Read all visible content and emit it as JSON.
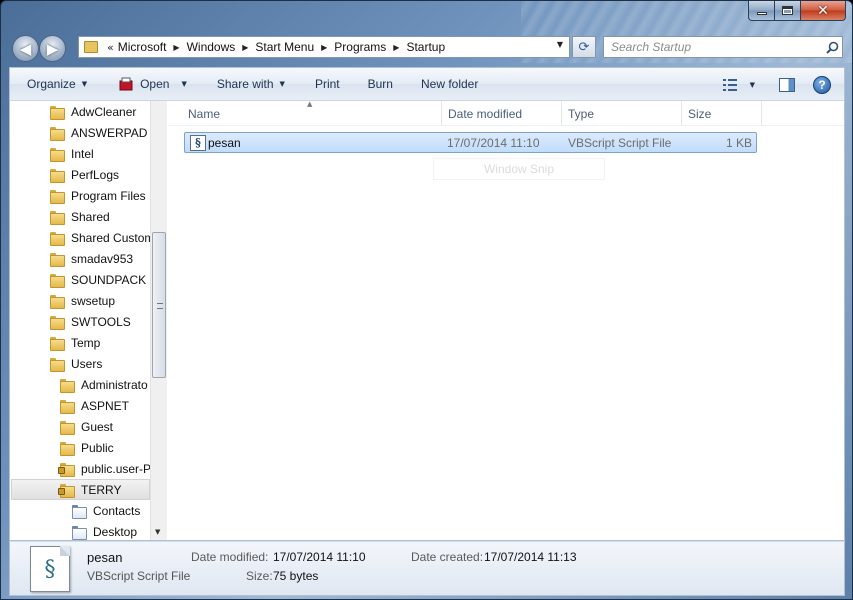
{
  "window": {
    "caption": {
      "minimize": "minimize",
      "maximize": "maximize",
      "close": "close"
    }
  },
  "address": {
    "prefix": "«",
    "segments": [
      "Microsoft",
      "Windows",
      "Start Menu",
      "Programs",
      "Startup"
    ]
  },
  "search": {
    "placeholder": "Search Startup"
  },
  "toolbar": {
    "organize": "Organize",
    "open": "Open",
    "share_with": "Share with",
    "print": "Print",
    "burn": "Burn",
    "new_folder": "New folder"
  },
  "tree": {
    "items": [
      {
        "label": "AdwCleaner",
        "icon": "folder-icon"
      },
      {
        "label": "ANSWERPAD",
        "icon": "folder-icon"
      },
      {
        "label": "Intel",
        "icon": "folder-icon"
      },
      {
        "label": "PerfLogs",
        "icon": "folder-icon"
      },
      {
        "label": "Program Files",
        "icon": "folder-icon"
      },
      {
        "label": "Shared",
        "icon": "folder-icon"
      },
      {
        "label": "Shared Custom",
        "icon": "folder-icon"
      },
      {
        "label": "smadav953",
        "icon": "folder-icon"
      },
      {
        "label": "SOUNDPACK",
        "icon": "folder-icon"
      },
      {
        "label": "swsetup",
        "icon": "folder-icon"
      },
      {
        "label": "SWTOOLS",
        "icon": "folder-icon"
      },
      {
        "label": "Temp",
        "icon": "folder-icon"
      },
      {
        "label": "Users",
        "icon": "folder-icon"
      },
      {
        "label": "Administrato",
        "icon": "folder-icon"
      },
      {
        "label": "ASPNET",
        "icon": "folder-icon"
      },
      {
        "label": "Guest",
        "icon": "folder-icon"
      },
      {
        "label": "Public",
        "icon": "folder-icon"
      },
      {
        "label": "public.user-P",
        "icon": "locked-folder-icon"
      },
      {
        "label": "TERRY",
        "icon": "locked-folder-icon"
      },
      {
        "label": "Contacts",
        "icon": "contacts-folder-icon"
      },
      {
        "label": "Desktop",
        "icon": "desktop-folder-icon"
      }
    ]
  },
  "columns": {
    "name": "Name",
    "date_modified": "Date modified",
    "type": "Type",
    "size": "Size"
  },
  "files": [
    {
      "name": "pesan",
      "date_modified": "17/07/2014 11:10",
      "type": "VBScript Script File",
      "size": "1 KB"
    }
  ],
  "overlay": {
    "snip": "Window Snip"
  },
  "details": {
    "name": "pesan",
    "type": "VBScript Script File",
    "date_modified_label": "Date modified:",
    "date_modified": "17/07/2014 11:10",
    "date_created_label": "Date created:",
    "date_created": "17/07/2014 11:13",
    "size_label": "Size:",
    "size": "75 bytes"
  },
  "colors": {
    "selection": "#c1dcfc",
    "selection_border": "#7da2ce",
    "toolbar_text": "#1e3250",
    "close_button": "#c0391b"
  }
}
